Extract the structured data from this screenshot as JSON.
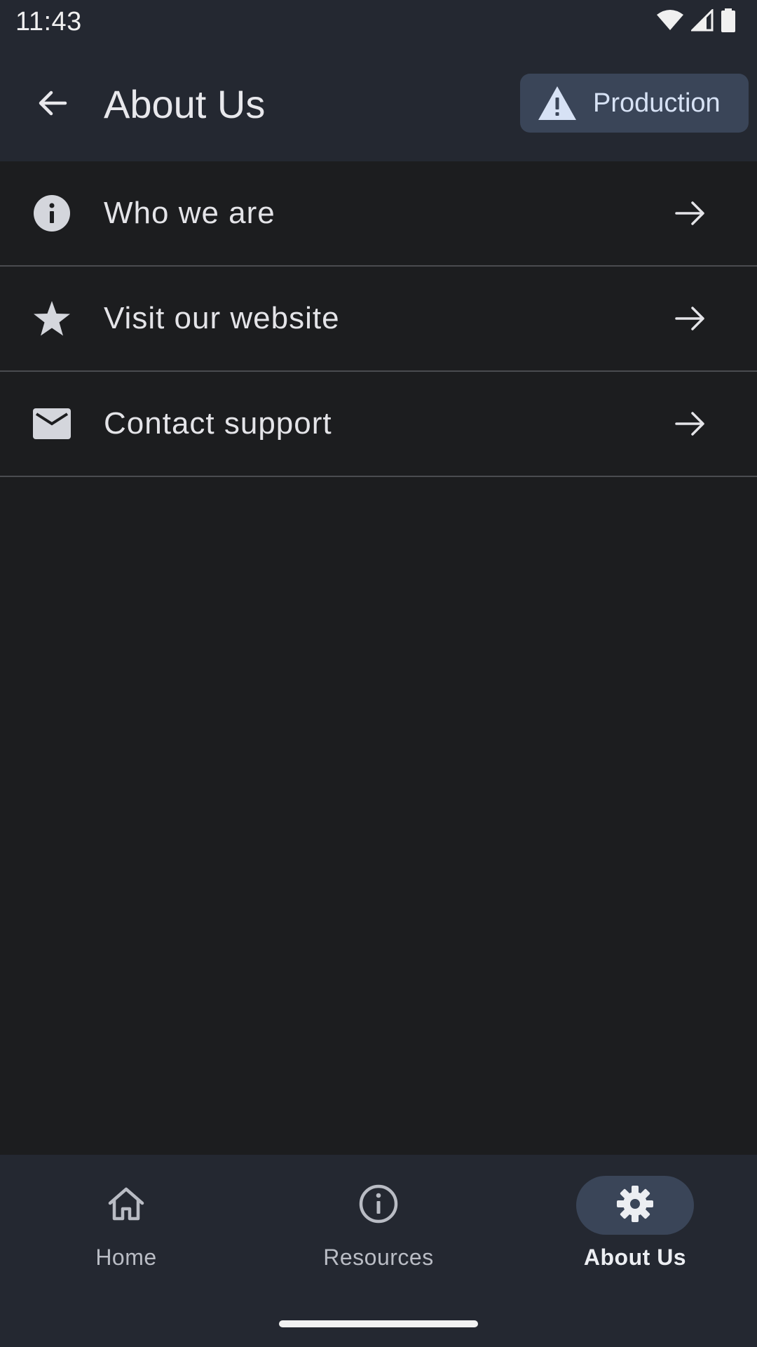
{
  "status_bar": {
    "time": "11:43"
  },
  "app_bar": {
    "title": "About Us",
    "environment_label": "Production"
  },
  "list": {
    "items": [
      {
        "label": "Who we are",
        "icon": "info-icon"
      },
      {
        "label": "Visit our website",
        "icon": "star-icon"
      },
      {
        "label": "Contact support",
        "icon": "mail-icon"
      }
    ]
  },
  "bottom_nav": {
    "items": [
      {
        "label": "Home",
        "icon": "home-icon",
        "active": false
      },
      {
        "label": "Resources",
        "icon": "info-outline-icon",
        "active": false
      },
      {
        "label": "About Us",
        "icon": "gear-icon",
        "active": true
      }
    ]
  },
  "colors": {
    "background": "#1c1d1f",
    "bar_background": "#242831",
    "accent_container": "#3a4558"
  }
}
